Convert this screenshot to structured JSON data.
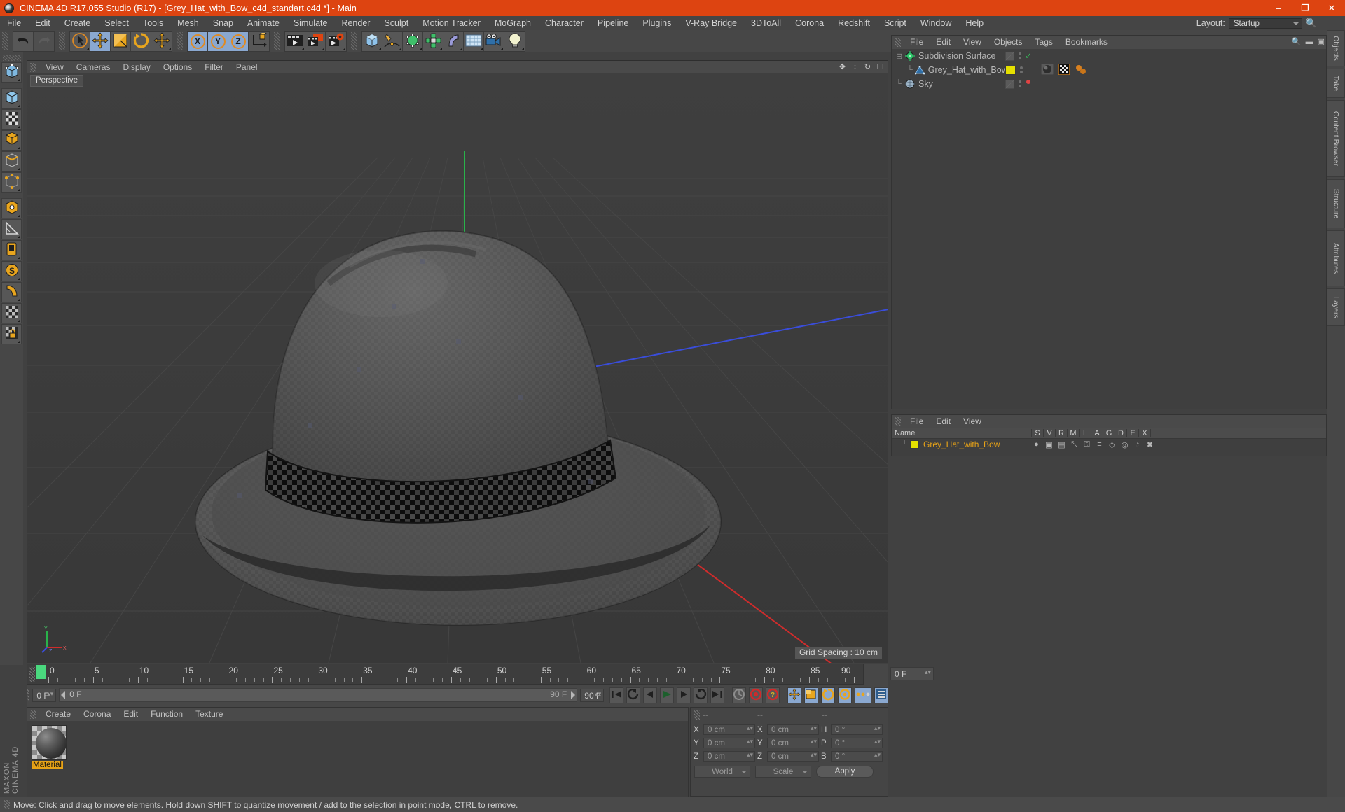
{
  "window": {
    "title": "CINEMA 4D R17.055 Studio (R17) - [Grey_Hat_with_Bow_c4d_standart.c4d *] - Main",
    "minimize": "–",
    "maximize": "❐",
    "close": "✕",
    "accent": "#dd4411"
  },
  "menubar": {
    "items": [
      "File",
      "Edit",
      "Create",
      "Select",
      "Tools",
      "Mesh",
      "Snap",
      "Animate",
      "Simulate",
      "Render",
      "Sculpt",
      "Motion Tracker",
      "MoGraph",
      "Character",
      "Pipeline",
      "Plugins",
      "V-Ray Bridge",
      "3DToAll",
      "Corona",
      "Redshift",
      "Script",
      "Window",
      "Help"
    ],
    "layout_label": "Layout:",
    "layout_value": "Startup"
  },
  "toolbar": {
    "groups": [
      {
        "name": "history",
        "buttons": [
          {
            "name": "undo-button",
            "icon": "undo-icon",
            "state": "normal"
          },
          {
            "name": "redo-button",
            "icon": "redo-icon",
            "state": "disabled"
          }
        ]
      },
      {
        "name": "transform",
        "buttons": [
          {
            "name": "select-tool-button",
            "icon": "live-selection-icon",
            "state": "normal"
          },
          {
            "name": "move-tool-button",
            "icon": "move-icon",
            "state": "active"
          },
          {
            "name": "scale-tool-button",
            "icon": "scale-icon",
            "state": "normal"
          },
          {
            "name": "rotate-tool-button",
            "icon": "rotate-icon",
            "state": "normal"
          },
          {
            "name": "extra-move-button",
            "icon": "move-icon",
            "state": "normal"
          }
        ]
      },
      {
        "name": "axis-locks",
        "buttons": [
          {
            "name": "lock-x-button",
            "icon": "axis-x-icon",
            "state": "active",
            "label": "X"
          },
          {
            "name": "lock-y-button",
            "icon": "axis-y-icon",
            "state": "active",
            "label": "Y"
          },
          {
            "name": "lock-z-button",
            "icon": "axis-z-icon",
            "state": "active",
            "label": "Z"
          },
          {
            "name": "world-object-coord-button",
            "icon": "world-coordinate-icon",
            "state": "normal"
          }
        ]
      },
      {
        "name": "render",
        "buttons": [
          {
            "name": "render-view-button",
            "icon": "render-view-icon",
            "state": "normal"
          },
          {
            "name": "render-region-button",
            "icon": "render-region-icon",
            "state": "normal"
          },
          {
            "name": "render-settings-button",
            "icon": "render-settings-icon",
            "state": "normal"
          }
        ]
      },
      {
        "name": "create",
        "buttons": [
          {
            "name": "add-cube-button",
            "icon": "cube-icon",
            "state": "normal"
          },
          {
            "name": "add-spline-button",
            "icon": "pen-spline-icon",
            "state": "normal"
          },
          {
            "name": "add-generator-button",
            "icon": "nurbs-generator-icon",
            "state": "normal"
          },
          {
            "name": "add-deformer-button",
            "icon": "mograph-array-icon",
            "state": "normal"
          },
          {
            "name": "add-bend-button",
            "icon": "bend-deformer-icon",
            "state": "normal"
          },
          {
            "name": "add-floor-button",
            "icon": "floor-environment-icon",
            "state": "normal"
          },
          {
            "name": "add-camera-button",
            "icon": "camera-icon",
            "state": "normal"
          },
          {
            "name": "add-light-button",
            "icon": "light-bulb-icon",
            "state": "normal"
          }
        ]
      }
    ]
  },
  "lefttools": {
    "buttons": [
      {
        "name": "make-editable-button",
        "icon": "make-editable-icon"
      },
      {
        "name": "model-mode-button",
        "icon": "model-mode-icon"
      },
      {
        "name": "texture-mode-button",
        "icon": "texture-mode-icon"
      },
      {
        "name": "polygon-mode-button",
        "icon": "polygon-mode-icon"
      },
      {
        "name": "edge-mode-button",
        "icon": "edge-mode-icon"
      },
      {
        "name": "point-mode-button",
        "icon": "point-mode-icon"
      },
      {
        "name": "object-axis-button",
        "icon": "object-axis-icon"
      },
      {
        "name": "ruler-tool-button",
        "icon": "ruler-icon"
      },
      {
        "name": "viewport-solo-button",
        "icon": "viewport-solo-icon"
      },
      {
        "name": "snap-toggle-button",
        "icon": "snap-magnet-icon"
      },
      {
        "name": "workplane-button",
        "icon": "workplane-icon"
      },
      {
        "name": "texture-lock-button",
        "icon": "texture-lock-icon"
      },
      {
        "name": "uv-lock-button",
        "icon": "uv-lock-icon"
      }
    ],
    "brand_top": "MAXON",
    "brand_bottom": "CINEMA 4D"
  },
  "viewport": {
    "menu": [
      "View",
      "Cameras",
      "Display",
      "Options",
      "Filter",
      "Panel"
    ],
    "label": "Perspective",
    "grid_spacing": "Grid Spacing : 10 cm",
    "nav_icons": [
      "move-view-icon",
      "scale-view-icon",
      "rotate-view-icon",
      "maximize-view-icon"
    ],
    "axis_gizmo": {
      "x": "X",
      "y": "Y",
      "z": "Z"
    },
    "scene_object": "Grey hat with bow (fedora)"
  },
  "timeline": {
    "ticks": [
      0,
      5,
      10,
      15,
      20,
      25,
      30,
      35,
      40,
      45,
      50,
      55,
      60,
      65,
      70,
      75,
      80,
      85,
      90
    ],
    "current_frame": "0 F",
    "range_start": "0 F",
    "range_end": "90 F",
    "max_frame": "90 F",
    "transport": [
      {
        "name": "goto-start-button",
        "icon": "skip-start-icon"
      },
      {
        "name": "step-back-keyframe-button",
        "icon": "prev-keyframe-icon"
      },
      {
        "name": "step-back-frame-button",
        "icon": "prev-frame-icon"
      },
      {
        "name": "play-button",
        "icon": "play-icon"
      },
      {
        "name": "step-forward-frame-button",
        "icon": "next-frame-icon"
      },
      {
        "name": "step-forward-keyframe-button",
        "icon": "next-keyframe-icon"
      },
      {
        "name": "goto-end-button",
        "icon": "skip-end-icon"
      }
    ],
    "record_group": [
      {
        "name": "record-active-objects-button",
        "icon": "record-keyframe-icon"
      },
      {
        "name": "autokeying-button",
        "icon": "autokey-icon"
      },
      {
        "name": "keyframe-selection-button",
        "icon": "keyframe-selection-icon"
      }
    ],
    "key_group": [
      {
        "name": "key-position-button",
        "icon": "key-position-icon"
      },
      {
        "name": "key-scale-button",
        "icon": "key-scale-icon"
      },
      {
        "name": "key-rotation-button",
        "icon": "key-rotation-icon"
      },
      {
        "name": "key-param-button",
        "icon": "key-param-icon"
      },
      {
        "name": "key-pla-button",
        "icon": "key-pla-icon"
      },
      {
        "name": "timeline-options-button",
        "icon": "timeline-options-icon"
      }
    ]
  },
  "material_manager": {
    "menu": [
      "Create",
      "Corona",
      "Edit",
      "Function",
      "Texture"
    ],
    "materials": [
      {
        "name": "Material",
        "selected": true
      }
    ]
  },
  "coordinates": {
    "header": [
      "--",
      "--",
      "--"
    ],
    "rows": [
      {
        "pos_label": "X",
        "pos_value": "0 cm",
        "size_label": "X",
        "size_value": "0 cm",
        "rot_label": "H",
        "rot_value": "0 °"
      },
      {
        "pos_label": "Y",
        "pos_value": "0 cm",
        "size_label": "Y",
        "size_value": "0 cm",
        "rot_label": "P",
        "rot_value": "0 °"
      },
      {
        "pos_label": "Z",
        "pos_value": "0 cm",
        "size_label": "Z",
        "size_value": "0 cm",
        "rot_label": "B",
        "rot_value": "0 °"
      }
    ],
    "coord_system": "World",
    "mode": "Scale",
    "apply": "Apply"
  },
  "object_manager": {
    "menu": [
      "File",
      "Edit",
      "View",
      "Objects",
      "Tags",
      "Bookmarks"
    ],
    "objects": [
      {
        "name": "Subdivision Surface",
        "icon": "subdivision-surface-icon",
        "indent": 0,
        "enabled_dot": "#35c25c",
        "dot_type": "check",
        "color": ""
      },
      {
        "name": "Grey_Hat_with_Bow",
        "icon": "polygon-object-icon",
        "indent": 1,
        "color": "#e5e000",
        "dot_type": "none",
        "tags": [
          "material-tag",
          "checker-texture-tag",
          "corona-tag"
        ]
      },
      {
        "name": "Sky",
        "icon": "sky-object-icon",
        "indent": 0,
        "enabled_dot": "#e04343",
        "dot_type": "dot",
        "color": ""
      }
    ]
  },
  "layer_manager": {
    "menu": [
      "File",
      "Edit",
      "View"
    ],
    "columns": [
      "Name",
      "S",
      "V",
      "R",
      "M",
      "L",
      "A",
      "G",
      "D",
      "E",
      "X"
    ],
    "rows": [
      {
        "name": "Grey_Hat_with_Bow",
        "color": "#e5e000"
      }
    ]
  },
  "right_tabs": [
    "Objects",
    "Take",
    "Content Browser",
    "Structure",
    "Attributes",
    "Layers"
  ],
  "status": {
    "message": "Move: Click and drag to move elements. Hold down SHIFT to quantize movement / add to the selection in point mode, CTRL to remove."
  }
}
